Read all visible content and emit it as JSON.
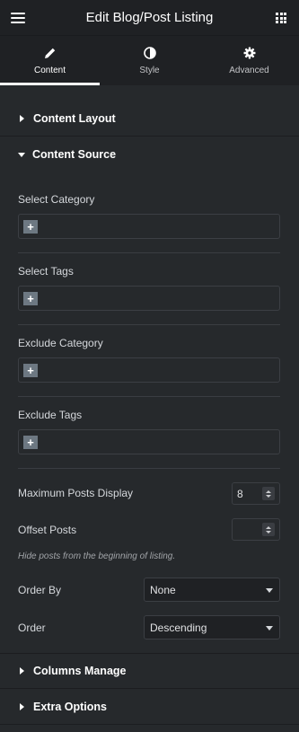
{
  "header": {
    "title": "Edit Blog/Post Listing",
    "menu_icon": "hamburger-icon",
    "apps_icon": "grid-icon"
  },
  "tabs": [
    {
      "label": "Content",
      "icon": "pencil-icon",
      "active": true
    },
    {
      "label": "Style",
      "icon": "half-circle-icon",
      "active": false
    },
    {
      "label": "Advanced",
      "icon": "gear-icon",
      "active": false
    }
  ],
  "sections": {
    "content_layout": "Content Layout",
    "content_source": "Content Source",
    "columns_manage": "Columns Manage",
    "extra_options": "Extra Options"
  },
  "fields": {
    "select_category": "Select Category",
    "select_tags": "Select Tags",
    "exclude_category": "Exclude Category",
    "exclude_tags": "Exclude Tags",
    "plus": "+",
    "max_posts_label": "Maximum Posts Display",
    "max_posts_value": "8",
    "offset_label": "Offset Posts",
    "offset_value": "",
    "offset_note": "Hide posts from the beginning of listing.",
    "order_by_label": "Order By",
    "order_by_value": "None",
    "order_label": "Order",
    "order_value": "Descending"
  },
  "colors": {
    "panel": "#26292c",
    "header": "#1f2124",
    "border": "#3c3f44",
    "text": "#e0e1e3"
  }
}
